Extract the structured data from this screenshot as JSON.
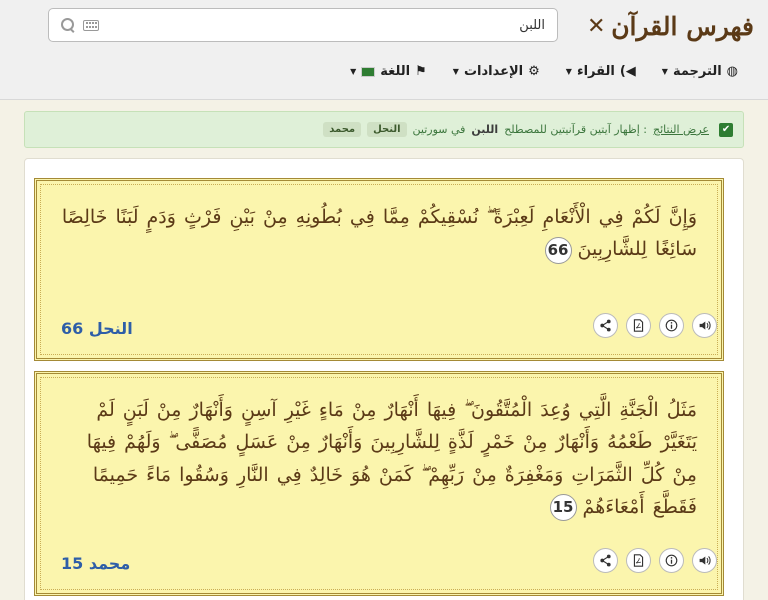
{
  "header": {
    "logo_text": "فهرس القرآن",
    "search": {
      "value": "اللبن",
      "placeholder": ""
    }
  },
  "nav": [
    {
      "label": "الترجمة",
      "icon": "globe-icon"
    },
    {
      "label": "القراء",
      "icon": "speaker-icon"
    },
    {
      "label": "الإعدادات",
      "icon": "gear-icon"
    },
    {
      "label": "اللغة",
      "icon": "flag-icon"
    }
  ],
  "notice": {
    "lead": "عرض النتائج",
    "text": ": إظهار آيتين قرآنيتين للمصطلح",
    "term": "اللبن",
    "suffix": "في سورتين",
    "surahs": [
      "النحل",
      "محمد"
    ]
  },
  "verses": [
    {
      "text": "وَإِنَّ لَكُمْ فِي الْأَنْعَامِ لَعِبْرَةً ۖ نُسْقِيكُمْ مِمَّا فِي بُطُونِهِ مِنْ بَيْنِ فَرْثٍ وَدَمٍ لَبَنًا خَالِصًا سَائِغًا لِلشَّارِبِينَ",
      "number": "66",
      "reference": "النحل 66"
    },
    {
      "text": "مَثَلُ الْجَنَّةِ الَّتِي وُعِدَ الْمُتَّقُونَ ۖ فِيهَا أَنْهَارٌ مِنْ مَاءٍ غَيْرِ آسِنٍ وَأَنْهَارٌ مِنْ لَبَنٍ لَمْ يَتَغَيَّرْ طَعْمُهُ وَأَنْهَارٌ مِنْ خَمْرٍ لَذَّةٍ لِلشَّارِبِينَ وَأَنْهَارٌ مِنْ عَسَلٍ مُصَفًّى ۖ وَلَهُمْ فِيهَا مِنْ كُلِّ الثَّمَرَاتِ وَمَغْفِرَةٌ مِنْ رَبِّهِمْ ۖ كَمَنْ هُوَ خَالِدٌ فِي النَّارِ وَسُقُوا مَاءً حَمِيمًا فَقَطَّعَ أَمْعَاءَهُمْ",
      "number": "15",
      "reference": "محمد 15"
    }
  ],
  "colors": {
    "accent": "#5b3a17",
    "card_bg": "#fbf5ad",
    "card_border": "#a48a36",
    "reference": "#2e5ea8"
  }
}
